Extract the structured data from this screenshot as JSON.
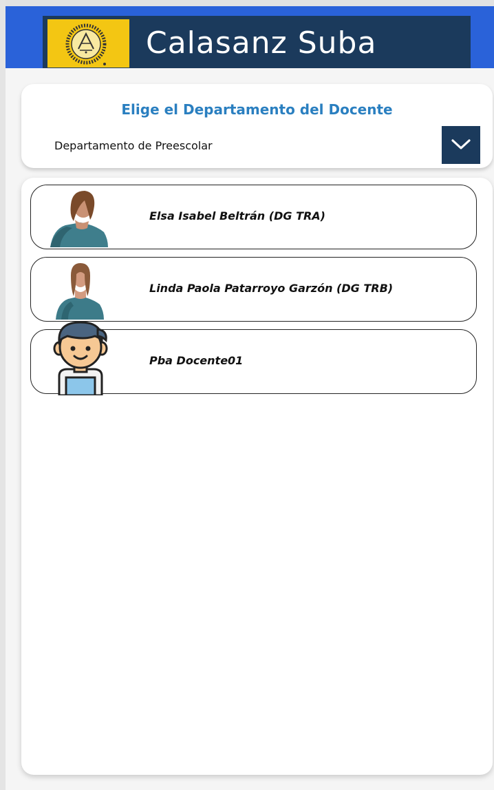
{
  "header": {
    "title": "Calasanz Suba",
    "brand_color": "#2a62d9",
    "inner_color": "#1b3a5c",
    "logo_color": "#f3c613"
  },
  "department": {
    "title": "Elige el Departamento del Docente",
    "selected": "Departamento de Preescolar",
    "dropdown_icon": "chevron-down-icon"
  },
  "teachers": [
    {
      "name": "Elsa Isabel Beltrán (DG TRA)",
      "photo": "teacher-photo"
    },
    {
      "name": "Linda Paola Patarroyo Garzón (DG TRB)",
      "photo": "teacher-photo"
    },
    {
      "name": "Pba Docente01",
      "photo": "avatar-icon"
    }
  ]
}
